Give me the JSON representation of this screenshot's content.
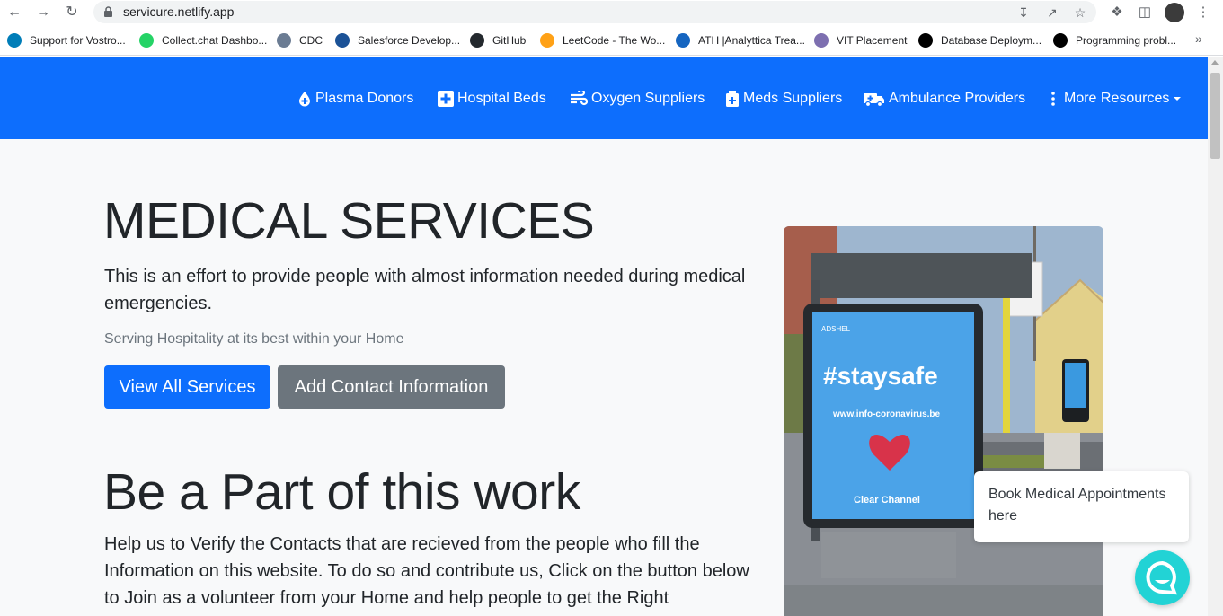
{
  "browser": {
    "url": "servicure.netlify.app",
    "bookmarks": [
      {
        "label": "Support for Vostro...",
        "color": "#007db8"
      },
      {
        "label": "Collect.chat Dashbo...",
        "color": "#25d366"
      },
      {
        "label": "CDC",
        "color": "#6b7c93"
      },
      {
        "label": "Salesforce Develop...",
        "color": "#1b5297"
      },
      {
        "label": "GitHub",
        "color": "#24292e"
      },
      {
        "label": "LeetCode - The Wo...",
        "color": "#ffa116"
      },
      {
        "label": "ATH |Analyttica Trea...",
        "color": "#1565c0"
      },
      {
        "label": "VIT Placement",
        "color": "#7d6fb0"
      },
      {
        "label": "Database Deploym...",
        "color": "#000000"
      },
      {
        "label": "Programming probl...",
        "color": "#000000"
      }
    ]
  },
  "nav": {
    "items": [
      {
        "label": "Plasma Donors",
        "icon": "blood-drop-icon"
      },
      {
        "label": "Hospital Beds",
        "icon": "plus-square-icon"
      },
      {
        "label": "Oxygen Suppliers",
        "icon": "wind-icon"
      },
      {
        "label": "Meds Suppliers",
        "icon": "medkit-icon"
      },
      {
        "label": "Ambulance Providers",
        "icon": "ambulance-icon"
      },
      {
        "label": "More Resources",
        "icon": "vertical-dots-icon"
      }
    ]
  },
  "hero": {
    "title": "MEDICAL SERVICES",
    "lead": "This is an effort to provide people with almost information needed during medical emergencies.",
    "tagline": "Serving Hospitality at its best within your Home",
    "primary_button": "View All Services",
    "secondary_button": "Add Contact Information",
    "image_text": "#staysafe",
    "image_subtext": "www.info-coronavirus.be",
    "image_brand": "Clear Channel"
  },
  "volunteer": {
    "title": "Be a Part of this work",
    "text": "Help us to Verify the Contacts that are recieved from the people who fill the Information on this website. To do so and contribute us, Click on the button below to Join as a volunteer from your Home and help people to get the Right"
  },
  "chat": {
    "bubble_text": "Book Medical Appointments here"
  },
  "colors": {
    "brand_primary": "#0d6efd",
    "secondary": "#6c757d",
    "chat_accent": "#22d3d5"
  }
}
